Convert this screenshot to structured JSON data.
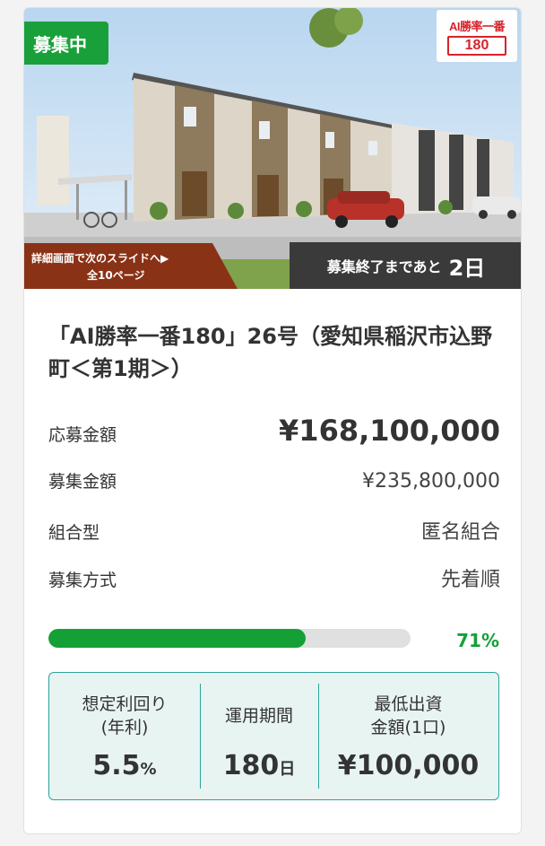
{
  "hero": {
    "badge": "募集中",
    "brand": {
      "line1": "AI勝率一番",
      "line2": "180"
    },
    "slide_hint": {
      "line1": "詳細画面で次のスライドへ▶",
      "line2": "全10ページ"
    },
    "deadline": {
      "prefix": "募集終了まであと",
      "days": "2日"
    }
  },
  "fund": {
    "title": "「AI勝率一番180」26号（愛知県稲沢市込野町＜第1期＞）",
    "rows": [
      {
        "label": "応募金額",
        "value": "¥168,100,000"
      },
      {
        "label": "募集金額",
        "value": "¥235,800,000"
      },
      {
        "label": "組合型",
        "value": "匿名組合"
      },
      {
        "label": "募集方式",
        "value": "先着順"
      }
    ],
    "progress": {
      "percent": 71,
      "label": "71%"
    }
  },
  "summary": {
    "yield": {
      "label_line1": "想定利回り",
      "label_line2": "(年利)",
      "value": "5.5",
      "unit": "%"
    },
    "term": {
      "label": "運用期間",
      "value": "180",
      "unit": "日"
    },
    "min_invest": {
      "label_line1": "最低出資",
      "label_line2": "金額(1口)",
      "value": "¥100,000"
    }
  },
  "colors": {
    "accent_green": "#14a037",
    "banner_brown": "#8a3216",
    "deadline_bg": "#3a3a3a",
    "box_border": "#2aa39a",
    "brand_red": "#d6232a"
  }
}
